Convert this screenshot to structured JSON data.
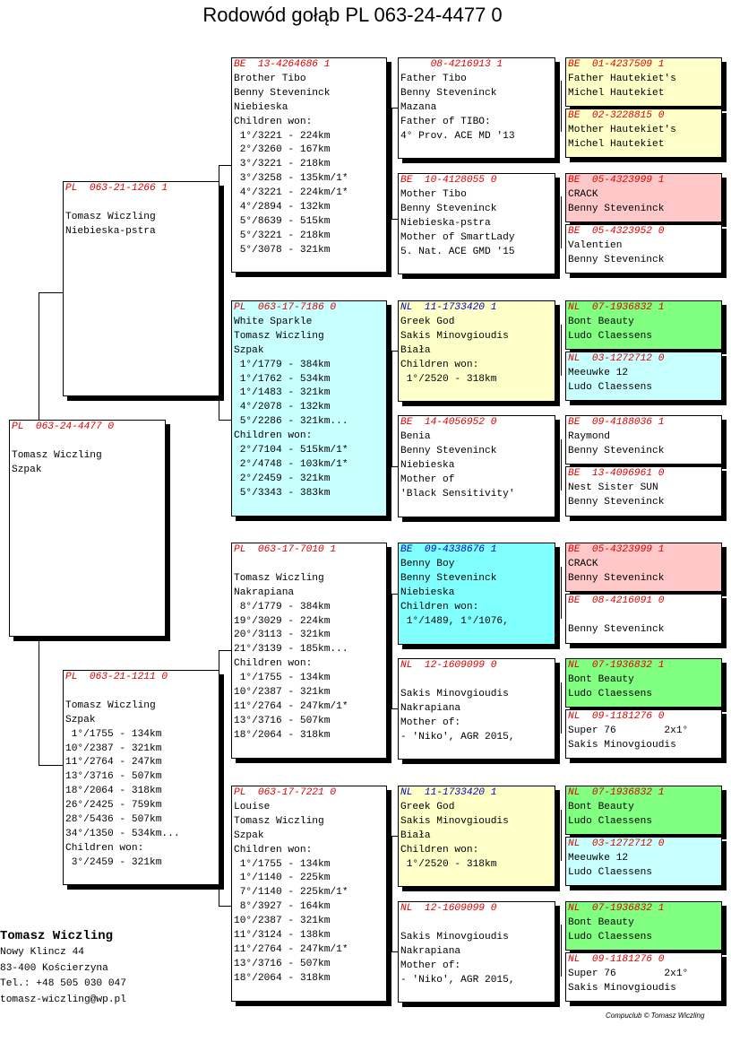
{
  "title": "Rodowód gołąb PL  063-24-4477 0",
  "colors": {
    "ring_red": "#e00000",
    "ring_blue": "#0000cc",
    "yellow": "#ffffc8",
    "cyan": "#c8ffff",
    "pink": "#ffc8c8",
    "green": "#80ff80",
    "turquoise": "#80ffff",
    "white": "#ffffff"
  },
  "birds": [
    {
      "ring": "PL  063-24-4477 0",
      "ring_color": "red",
      "bg": "white",
      "lines": [
        "",
        "Tomasz Wiczling",
        "Szpak"
      ]
    },
    {
      "ring": "PL  063-21-1266 1",
      "ring_color": "red",
      "bg": "white",
      "lines": [
        "",
        "Tomasz Wiczling",
        "Niebieska-pstra"
      ]
    },
    {
      "ring": "PL  063-21-1211 0",
      "ring_color": "red",
      "bg": "white",
      "lines": [
        "",
        "Tomasz Wiczling",
        "Szpak",
        " 1°/1755 - 134km",
        "10°/2387 - 321km",
        "11°/2764 - 247km",
        "13°/3716 - 507km",
        "18°/2064 - 318km",
        "26°/2425 - 759km",
        "28°/5436 - 507km",
        "34°/1350 - 534km...",
        "Children won:",
        " 3°/2459 - 321km"
      ]
    },
    {
      "ring": "BE  13-4264686 1",
      "ring_color": "red",
      "bg": "white",
      "lines": [
        "Brother Tibo",
        "Benny Steveninck",
        "Niebieska",
        "Children won:",
        " 1°/3221 - 224km",
        " 2°/3260 - 167km",
        " 3°/3221 - 218km",
        " 3°/3258 - 135km/1*",
        " 4°/3221 - 224km/1*",
        " 4°/2894 - 132km",
        " 5°/8639 - 515km",
        " 5°/3221 - 218km",
        " 5°/3078 - 321km"
      ]
    },
    {
      "ring": "PL  063-17-7186 0",
      "ring_color": "red",
      "bg": "cyan",
      "lines": [
        "White Sparkle",
        "Tomasz Wiczling",
        "Szpak",
        " 1°/1779 - 384km",
        " 1°/1762 - 534km",
        " 1°/1483 - 321km",
        " 4°/2078 - 132km",
        " 5°/2286 - 321km...",
        "Children won:",
        " 2°/7104 - 515km/1*",
        " 2°/4748 - 103km/1*",
        " 2°/2459 - 321km",
        " 5°/3343 - 383km"
      ]
    },
    {
      "ring": "PL  063-17-7010 1",
      "ring_color": "red",
      "bg": "white",
      "lines": [
        "",
        "Tomasz Wiczling",
        "Nakrapiana",
        " 8°/1779 - 384km",
        "19°/3029 - 224km",
        "20°/3113 - 321km",
        "21°/3139 - 185km...",
        "Children won:",
        " 1°/1755 - 134km",
        "10°/2387 - 321km",
        "11°/2764 - 247km/1*",
        "13°/3716 - 507km",
        "18°/2064 - 318km"
      ]
    },
    {
      "ring": "PL  063-17-7221 0",
      "ring_color": "red",
      "bg": "white",
      "lines": [
        "Louise",
        "Tomasz Wiczling",
        "Szpak",
        "Children won:",
        " 1°/1755 - 134km",
        " 1°/1140 - 225km",
        " 7°/1140 - 225km/1*",
        " 8°/3927 - 164km",
        "10°/2387 - 321km",
        "11°/3124 - 138km",
        "11°/2764 - 247km/1*",
        "13°/3716 - 507km",
        "18°/2064 - 318km"
      ]
    },
    {
      "ring": "     08-4216913 1",
      "ring_color": "red",
      "bg": "white",
      "lines": [
        "Father Tibo",
        "Benny Steveninck",
        "Mazana",
        "Father of TIBO:",
        "4° Prov. ACE MD '13"
      ]
    },
    {
      "ring": "BE  10-4128055 0",
      "ring_color": "red",
      "bg": "white",
      "lines": [
        "Mother Tibo",
        "Benny Steveninck",
        "Niebieska-pstra",
        "Mother of SmartLady",
        "5. Nat. ACE GMD '15"
      ]
    },
    {
      "ring": "NL  11-1733420 1",
      "ring_color": "blue",
      "bg": "yellow",
      "lines": [
        "Greek God",
        "Sakis Minovgioudis",
        "Biała",
        "Children won:",
        " 1°/2520 - 318km"
      ]
    },
    {
      "ring": "BE  14-4056952 0",
      "ring_color": "red",
      "bg": "white",
      "lines": [
        "Benia",
        "Benny Steveninck",
        "Niebieska",
        "Mother of",
        "'Black Sensitivity'"
      ]
    },
    {
      "ring": "BE  09-4338676 1",
      "ring_color": "blue",
      "bg": "turquoise",
      "lines": [
        "Benny Boy",
        "Benny Steveninck",
        "Niebieska",
        "Children won:",
        " 1°/1489, 1°/1076,"
      ]
    },
    {
      "ring": "NL  12-1609099 0",
      "ring_color": "red",
      "bg": "white",
      "lines": [
        "",
        "Sakis Minovgioudis",
        "Nakrapiana",
        "Mother of:",
        "- 'Niko', AGR 2015,"
      ]
    },
    {
      "ring": "NL  11-1733420 1",
      "ring_color": "blue",
      "bg": "yellow",
      "lines": [
        "Greek God",
        "Sakis Minovgioudis",
        "Biała",
        "Children won:",
        " 1°/2520 - 318km"
      ]
    },
    {
      "ring": "NL  12-1609099 0",
      "ring_color": "red",
      "bg": "white",
      "lines": [
        "",
        "Sakis Minovgioudis",
        "Nakrapiana",
        "Mother of:",
        "- 'Niko', AGR 2015,"
      ]
    },
    {
      "ring": "BE  01-4237509 1",
      "ring_color": "red",
      "bg": "yellow",
      "lines": [
        "Father Hautekiet's",
        "Michel Hautekiet"
      ]
    },
    {
      "ring": "BE  02-3228815 0",
      "ring_color": "red",
      "bg": "yellow",
      "lines": [
        "Mother Hautekiet's",
        "Michel Hautekiet"
      ]
    },
    {
      "ring": "BE  05-4323999 1",
      "ring_color": "red",
      "bg": "pink",
      "lines": [
        "CRACK",
        "Benny Steveninck"
      ]
    },
    {
      "ring": "BE  05-4323952 0",
      "ring_color": "red",
      "bg": "white",
      "lines": [
        "Valentien",
        "Benny Steveninck"
      ]
    },
    {
      "ring": "NL  07-1936832 1",
      "ring_color": "red",
      "bg": "green",
      "lines": [
        "Bont Beauty",
        "Ludo Claessens"
      ]
    },
    {
      "ring": "NL  03-1272712 0",
      "ring_color": "red",
      "bg": "cyan",
      "lines": [
        "Meeuwke 12",
        "Ludo Claessens"
      ]
    },
    {
      "ring": "BE  09-4188036 1",
      "ring_color": "red",
      "bg": "white",
      "lines": [
        "Raymond",
        "Benny Steveninck"
      ]
    },
    {
      "ring": "BE  13-4096961 0",
      "ring_color": "red",
      "bg": "white",
      "lines": [
        "Nest Sister SUN",
        "Benny Steveninck"
      ]
    },
    {
      "ring": "BE  05-4323999 1",
      "ring_color": "red",
      "bg": "pink",
      "lines": [
        "CRACK",
        "Benny Steveninck"
      ]
    },
    {
      "ring": "BE  08-4216091 0",
      "ring_color": "red",
      "bg": "white",
      "lines": [
        "",
        "Benny Steveninck"
      ]
    },
    {
      "ring": "NL  07-1936832 1",
      "ring_color": "red",
      "bg": "green",
      "lines": [
        "Bont Beauty",
        "Ludo Claessens"
      ]
    },
    {
      "ring": "NL  09-1181276 0",
      "ring_color": "red",
      "bg": "white",
      "lines": [
        "Super 76        2x1°",
        "Sakis Minovgioudis"
      ]
    },
    {
      "ring": "NL  07-1936832 1",
      "ring_color": "red",
      "bg": "green",
      "lines": [
        "Bont Beauty",
        "Ludo Claessens"
      ]
    },
    {
      "ring": "NL  03-1272712 0",
      "ring_color": "red",
      "bg": "cyan",
      "lines": [
        "Meeuwke 12",
        "Ludo Claessens"
      ]
    },
    {
      "ring": "NL  07-1936832 1",
      "ring_color": "red",
      "bg": "green",
      "lines": [
        "Bont Beauty",
        "Ludo Claessens"
      ]
    },
    {
      "ring": "NL  09-1181276 0",
      "ring_color": "red",
      "bg": "white",
      "lines": [
        "Super 76        2x1°",
        "Sakis Minovgioudis"
      ]
    }
  ],
  "breeder": {
    "name": "Tomasz Wiczling",
    "address1": "Nowy Klincz 44",
    "address2": "83-400  Kościerzyna",
    "phone": "Tel.: +48 505 030 047",
    "email": "tomasz-wiczling@wp.pl"
  },
  "footer": "Compuclub © Tomasz Wiczling"
}
